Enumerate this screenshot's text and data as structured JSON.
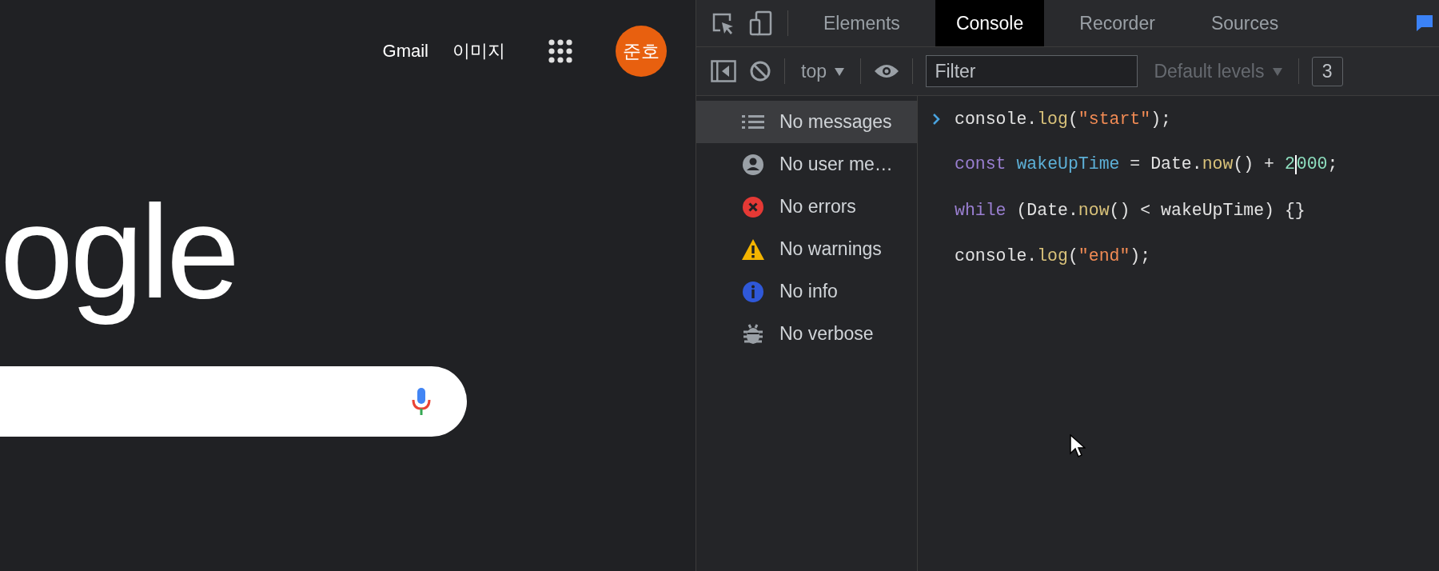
{
  "page": {
    "header_links": [
      "Gmail",
      "이미지"
    ],
    "avatar": "준호",
    "logo": "ogle",
    "search": {
      "kind": "search"
    }
  },
  "devtools": {
    "tabs": [
      {
        "label": "Elements",
        "selected": false
      },
      {
        "label": "Console",
        "selected": true
      },
      {
        "label": "Recorder",
        "selected": false
      },
      {
        "label": "Sources",
        "selected": false
      }
    ],
    "toolbar": {
      "context": "top",
      "filter": {
        "placeholder": "Filter"
      },
      "levels": "Default levels",
      "issues": "3"
    },
    "sidebar": [
      {
        "kind": "list",
        "label": "No messages",
        "selected": true
      },
      {
        "kind": "user",
        "label": "No user me…",
        "selected": false
      },
      {
        "kind": "error",
        "label": "No errors",
        "selected": false
      },
      {
        "kind": "warning",
        "label": "No warnings",
        "selected": false
      },
      {
        "kind": "info",
        "label": "No info",
        "selected": false
      },
      {
        "kind": "verbose",
        "label": "No verbose",
        "selected": false
      }
    ],
    "code": [
      [
        {
          "text": "console.",
          "kind": "plain"
        },
        {
          "text": "log",
          "kind": "method"
        },
        {
          "text": "(",
          "kind": "plain"
        },
        {
          "text": "\"start\"",
          "kind": "string"
        },
        {
          "text": ");",
          "kind": "plain"
        }
      ],
      [
        {
          "text": "const ",
          "kind": "keyword"
        },
        {
          "text": "wakeUpTime",
          "kind": "variable"
        },
        {
          "text": " = Date.",
          "kind": "plain"
        },
        {
          "text": "now",
          "kind": "method"
        },
        {
          "text": "() + ",
          "kind": "plain"
        },
        {
          "text": "2",
          "kind": "number",
          "caret_after": true
        },
        {
          "text": "000",
          "kind": "number"
        },
        {
          "text": ";",
          "kind": "plain"
        }
      ],
      [
        {
          "text": "while ",
          "kind": "keyword"
        },
        {
          "text": "(Date.",
          "kind": "plain"
        },
        {
          "text": "now",
          "kind": "method"
        },
        {
          "text": "() < wakeUpTime) {}",
          "kind": "plain"
        }
      ],
      [
        {
          "text": "console.",
          "kind": "plain"
        },
        {
          "text": "log",
          "kind": "method"
        },
        {
          "text": "(",
          "kind": "plain"
        },
        {
          "text": "\"end\"",
          "kind": "string"
        },
        {
          "text": ");",
          "kind": "plain"
        }
      ]
    ]
  }
}
